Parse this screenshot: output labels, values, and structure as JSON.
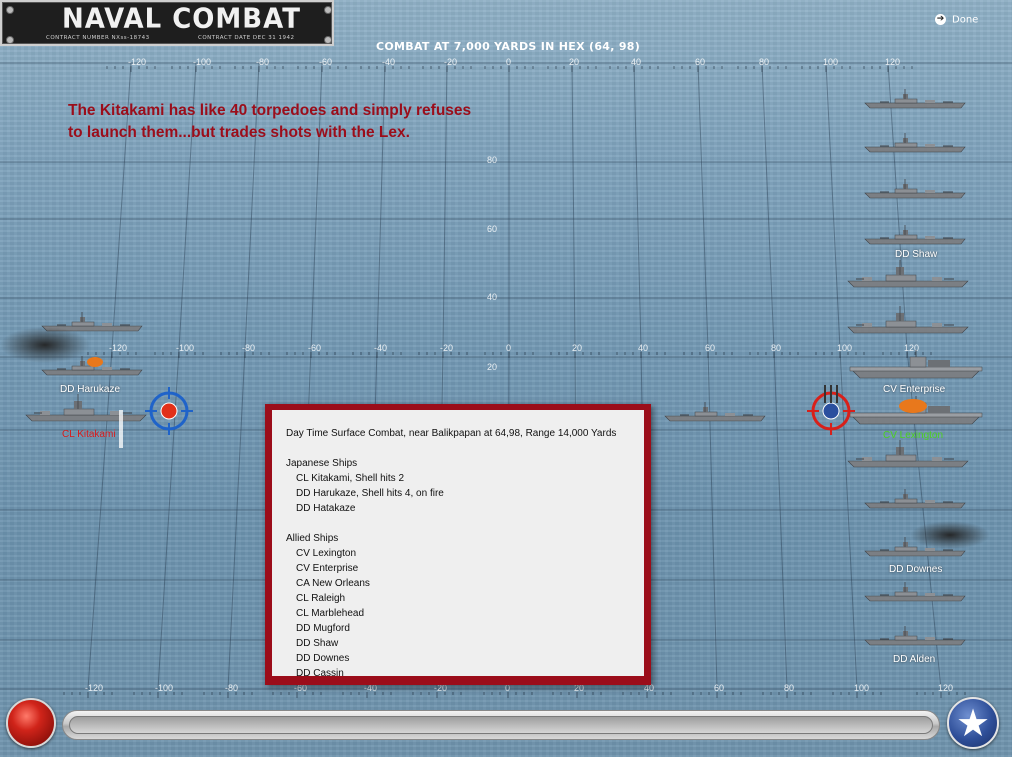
{
  "header": {
    "logo_title": "NAVAL COMBAT",
    "logo_contract_number": "CONTRACT NUMBER   NXss-18743",
    "logo_contract_date": "CONTRACT DATE   DEC 31 1942",
    "done_label": "Done",
    "combat_title": "COMBAT AT 7,000 YARDS IN HEX (64, 98)"
  },
  "annotation": {
    "line1": "The Kitakami has like 40 torpedoes and simply refuses",
    "line2": "to launch them...but trades shots with the Lex."
  },
  "grid": {
    "top_x_ticks": [
      "-120",
      "-100",
      "-80",
      "-60",
      "-40",
      "-20",
      "0",
      "20",
      "40",
      "60",
      "80",
      "100",
      "120"
    ],
    "mid_x_ticks": [
      "-120",
      "-100",
      "-80",
      "-60",
      "-40",
      "-20",
      "0",
      "20",
      "40",
      "60",
      "80",
      "100",
      "120"
    ],
    "bottom_x_ticks": [
      "-120",
      "-100",
      "-80",
      "-60",
      "-40",
      "-20",
      "0",
      "20",
      "40",
      "60",
      "80",
      "100",
      "120"
    ],
    "y_ticks": [
      "80",
      "60",
      "40",
      "20",
      "0"
    ]
  },
  "ship_labels": {
    "dd_harukaze": "DD Harukaze",
    "cl_kitakami": "CL Kitakami",
    "dd_shaw": "DD Shaw",
    "cv_enterprise": "CV Enterprise",
    "cv_lexington": "CV Lexington",
    "dd_downes": "DD Downes",
    "dd_alden": "DD Alden"
  },
  "report": {
    "heading": "Day Time Surface Combat, near Balikpapan at 64,98, Range 14,000 Yards",
    "japanese_header": "Japanese Ships",
    "japanese_ships": [
      "CL Kitakami, Shell hits 2",
      "DD Harukaze, Shell hits 4,  on fire",
      "DD Hatakaze"
    ],
    "allied_header": "Allied Ships",
    "allied_ships": [
      "CV Lexington",
      "CV Enterprise",
      "CA New Orleans",
      "CL Raleigh",
      "CL Marblehead",
      "DD Mugford",
      "DD Shaw",
      "DD Downes",
      "DD Cassin"
    ]
  },
  "controls": {
    "fire_button_icon": "red-circle-icon",
    "allied_button_icon": "star-icon",
    "progress": 0
  }
}
